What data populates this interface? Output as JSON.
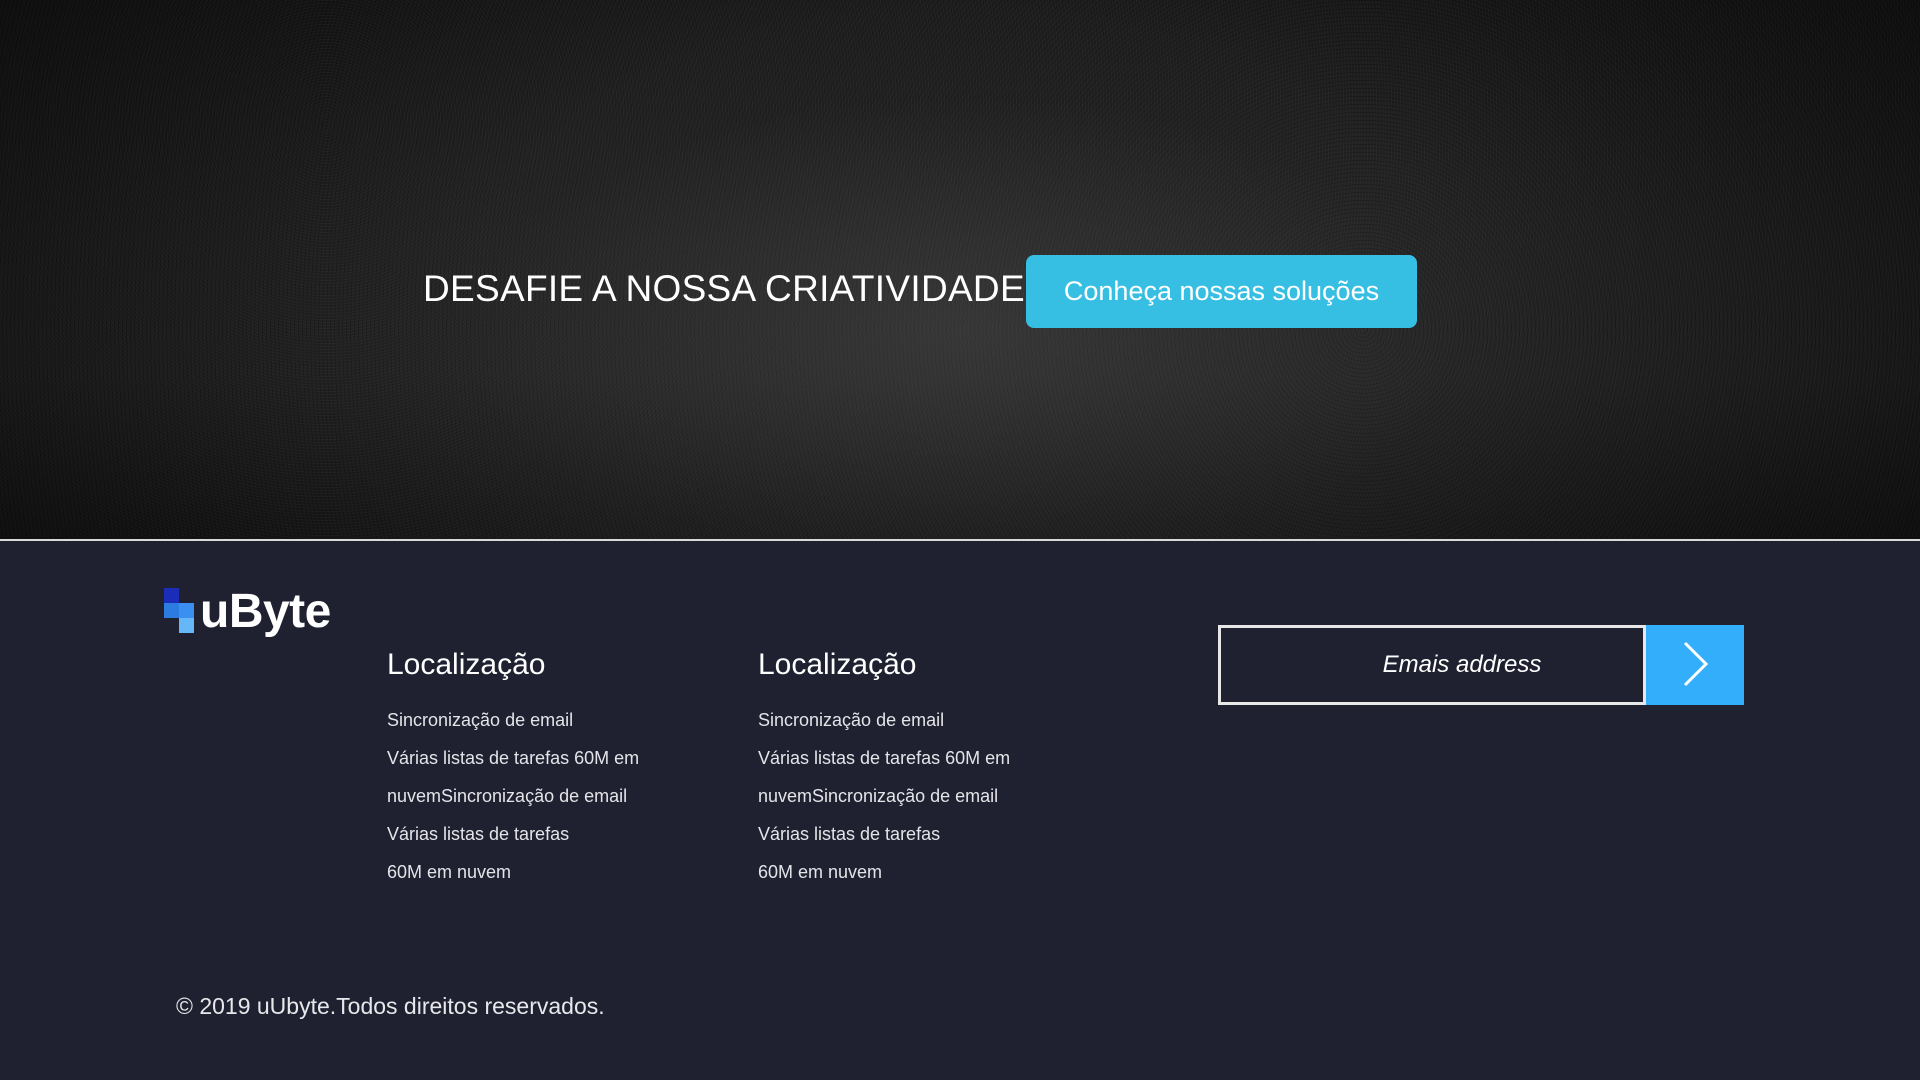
{
  "hero": {
    "headline": "DESAFIE A NOSSA CRIATIVIDADE",
    "cta_label": "Conheça nossas soluções"
  },
  "footer": {
    "logo_text": "uByte",
    "columns": [
      {
        "title": "Localização",
        "items": [
          "Sincronização de email",
          "Várias listas de tarefas 60M em",
          "nuvemSincronização de email",
          "Várias listas de tarefas",
          "60M em nuvem"
        ]
      },
      {
        "title": "Localização",
        "items": [
          "Sincronização de email",
          "Várias listas de tarefas 60M em",
          "nuvemSincronização de email",
          "Várias listas de tarefas",
          "60M em nuvem"
        ]
      }
    ],
    "newsletter": {
      "placeholder": "Emais address",
      "submit_icon": "chevron-right-icon"
    },
    "copyright": "© 2019 uUbyte.Todos direitos reservados."
  },
  "colors": {
    "cta_background": "#37bfe3",
    "submit_background": "#33aefb",
    "footer_background": "#1f2130",
    "logo_squares": [
      "#1a2cb8",
      "#2b7be0",
      "#3b8ff0",
      "#66b7f8"
    ]
  }
}
